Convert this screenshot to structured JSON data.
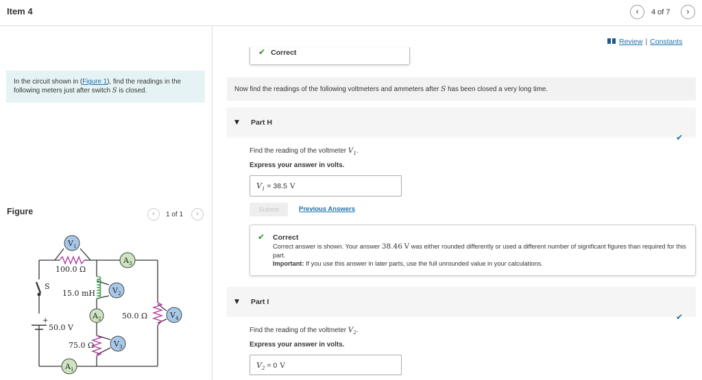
{
  "header": {
    "item_title": "Item 4",
    "nav_prev_icon": "chevron-left-icon",
    "nav_next_icon": "chevron-right-icon",
    "position": "4 of 7"
  },
  "links": {
    "review": "Review",
    "separator": "|",
    "constants": "Constants"
  },
  "intro": {
    "prefix": "In the circuit shown in (",
    "figure_link": "Figure 1",
    "middle": "), find the readings in the following meters just after switch",
    "var": "S",
    "suffix": "is closed."
  },
  "figure": {
    "label": "Figure",
    "count": "1 of 1",
    "circuit_labels": {
      "r1": "100.0 Ω",
      "l1": "15.0 mH",
      "emf": "50.0 V",
      "r2": "75.0 Ω",
      "r3": "50.0 Ω",
      "switch": "S",
      "plus": "+",
      "v1": "V",
      "v1_sub": "1",
      "v2": "V",
      "v2_sub": "2",
      "v3": "V",
      "v3_sub": "3",
      "v4": "V",
      "v4_sub": "4",
      "a1": "A",
      "a1_sub": "1",
      "a2": "A",
      "a2_sub": "2",
      "a3": "A",
      "a3_sub": "3"
    }
  },
  "previous_feedback": {
    "title": "Correct"
  },
  "instruction": {
    "prefix": "Now find the readings of the following voltmeters and ammeters after",
    "var": "S",
    "suffix": "has been closed a very long time."
  },
  "part_h": {
    "title": "Part H",
    "question_prefix": "Find the reading of the voltmeter",
    "question_var": "V",
    "question_sub": "1",
    "question_suffix": ".",
    "express": "Express your answer in volts.",
    "answer_var": "V",
    "answer_sub": "1",
    "answer_eq": "=",
    "answer_value": "38.5",
    "answer_unit": "V",
    "submit": "Submit",
    "previous_answers": "Previous Answers",
    "feedback_title": "Correct",
    "feedback_msg_1": "Correct answer is shown. Your answer",
    "feedback_value": "38.46",
    "feedback_unit": "V",
    "feedback_msg_2": "was either rounded differently or used a different number of significant figures than required for this part.",
    "important_label": "Important:",
    "important_text": "If you use this answer in later parts, use the full unrounded value in your calculations."
  },
  "part_i": {
    "title": "Part I",
    "question_prefix": "Find the reading of the voltmeter",
    "question_var": "V",
    "question_sub": "2",
    "question_suffix": ".",
    "express": "Express your answer in volts.",
    "answer_var": "V",
    "answer_sub": "2",
    "answer_eq": "=",
    "answer_value": "0",
    "answer_unit": "V"
  },
  "colors": {
    "link": "#1a6fa8",
    "correct_green": "#2e8b2e",
    "intro_bg": "#e6f3f5"
  }
}
